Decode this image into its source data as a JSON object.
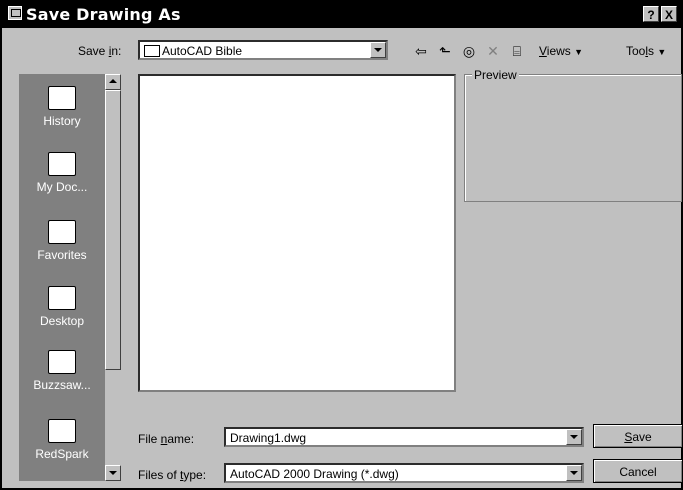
{
  "window": {
    "title": "Save Drawing As",
    "help_label": "?",
    "close_label": "X"
  },
  "toolbar": {
    "save_in_label_pre": "Save ",
    "save_in_label_u": "i",
    "save_in_label_post": "n:",
    "location_value": "AutoCAD Bible",
    "back_icon": "⇦",
    "up_folder_icon": "⬑",
    "search_web_icon": "◎",
    "delete_icon": "✕",
    "new_folder_icon": "⌸",
    "views_label_u": "V",
    "views_label_post": "iews",
    "tools_label_pre": "Too",
    "tools_label_u": "l",
    "tools_label_post": "s"
  },
  "places": [
    {
      "label": "History",
      "icon": "history-icon"
    },
    {
      "label": "My Doc...",
      "icon": "my-documents-icon"
    },
    {
      "label": "Favorites",
      "icon": "favorites-icon"
    },
    {
      "label": "Desktop",
      "icon": "desktop-icon"
    },
    {
      "label": "Buzzsaw...",
      "icon": "buzzsaw-icon"
    },
    {
      "label": "RedSpark",
      "icon": "redspark-icon"
    }
  ],
  "preview": {
    "label": "Preview"
  },
  "form": {
    "file_name_pre": "File ",
    "file_name_u": "n",
    "file_name_post": "ame:",
    "file_name_value": "Drawing1.dwg",
    "file_type_pre": "Files of ",
    "file_type_u": "t",
    "file_type_post": "ype:",
    "file_type_value": "AutoCAD 2000 Drawing (*.dwg)"
  },
  "buttons": {
    "save_u": "S",
    "save_post": "ave",
    "cancel": "Cancel"
  }
}
